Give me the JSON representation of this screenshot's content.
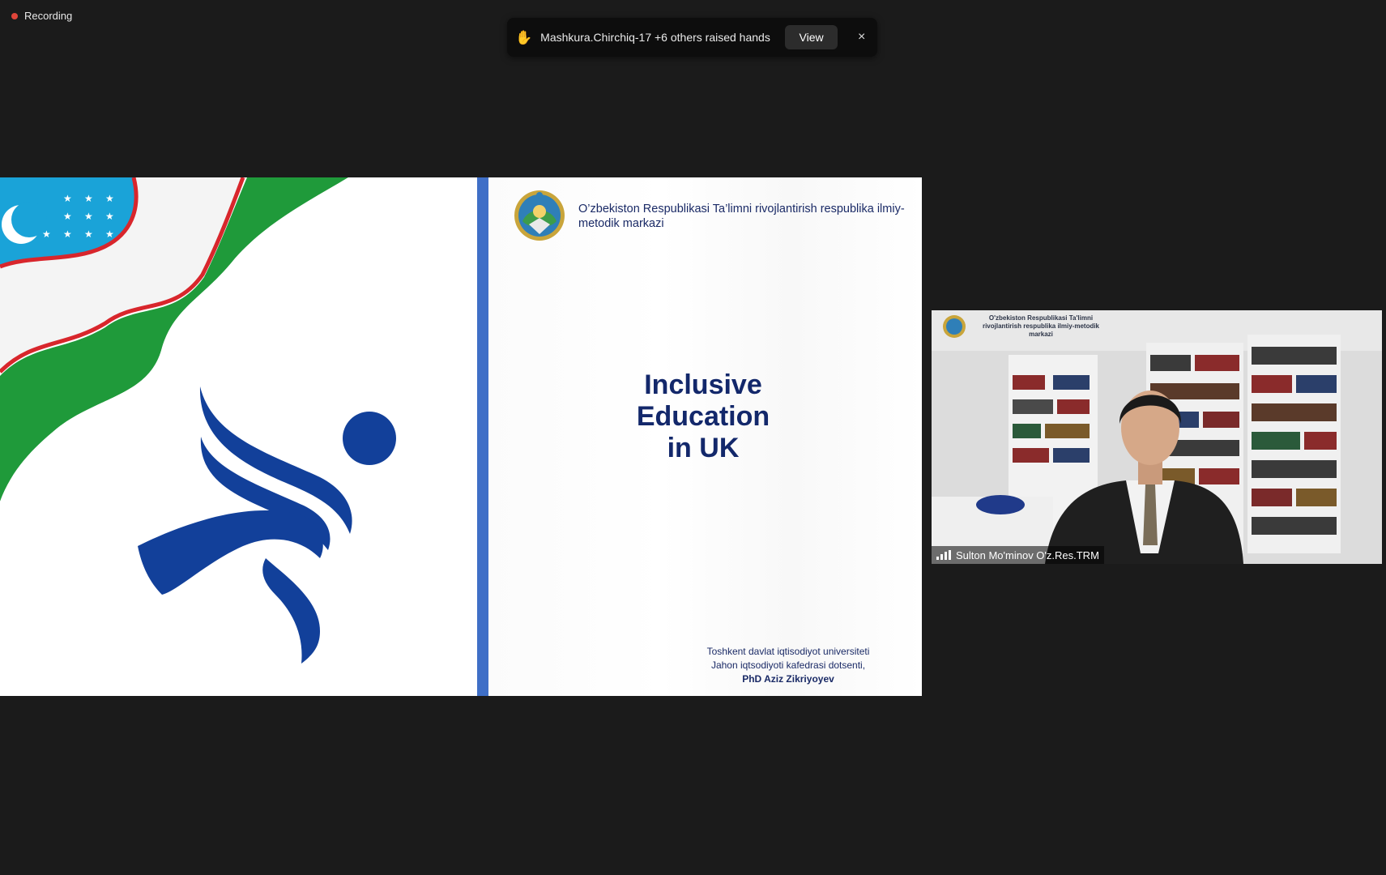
{
  "recording": {
    "label": "Recording"
  },
  "raised_hands": {
    "message": "Mashkura.Chirchiq-17 +6 others raised hands",
    "view_label": "View",
    "close_glyph": "×"
  },
  "slide": {
    "org_name": "O’zbekiston Respublikasi Ta’limni rivojlantirish respublika ilmiy-metodik markazi",
    "title_lines": [
      "Inclusive",
      "Education",
      "in UK"
    ],
    "author_lines": [
      "Toshkent davlat iqtisodiyot universiteti",
      "Jahon iqtsodiyoti kafedrasi dotsenti,"
    ],
    "author_name": "PhD Aziz Zikriyoyev",
    "colors": {
      "navy": "#13286b",
      "divider_blue": "#3f6fc7",
      "flag_blue": "#1aa3d8",
      "flag_green": "#1f9a3a",
      "flag_red": "#d8262c"
    }
  },
  "participant_video": {
    "name": "Sulton Mo'minov O'z.Res.TRM",
    "overlay_text": "O'zbekiston Respublikasi Ta'limni rivojlantirish respublika ilmiy-metodik markazi"
  }
}
